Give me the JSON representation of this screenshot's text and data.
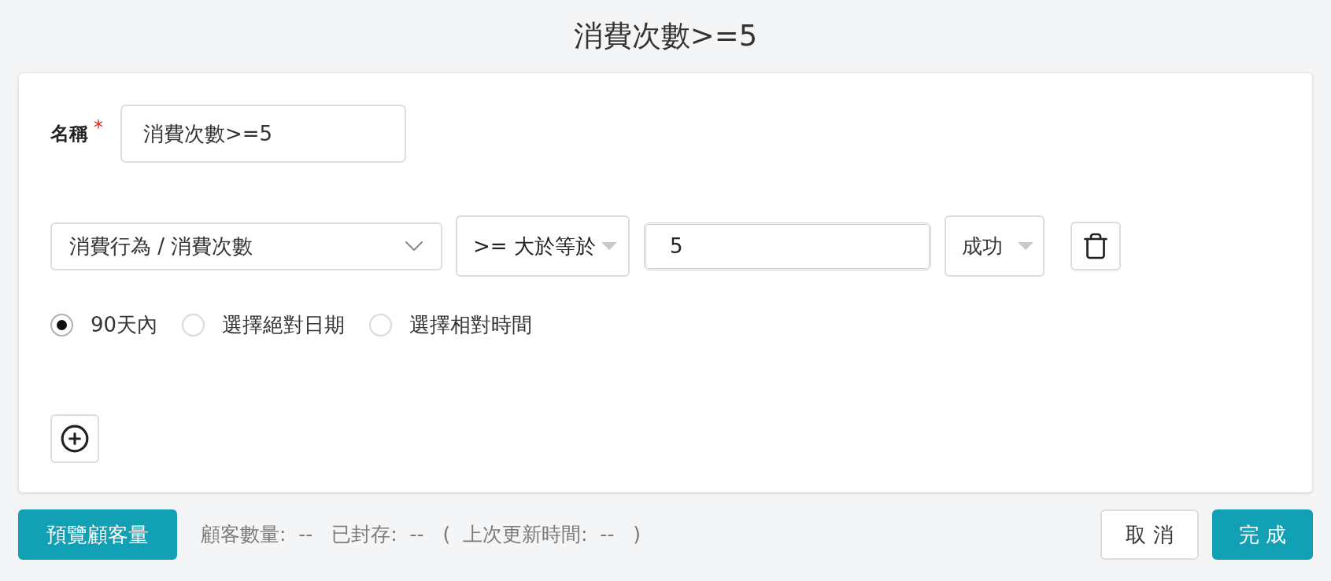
{
  "page_title": "消費次數>=5",
  "name_field": {
    "label": "名稱",
    "required_mark": "*",
    "value": "消費次數>=5"
  },
  "conditions": [
    {
      "field": {
        "value": "消費行為 / 消費次數"
      },
      "operator": {
        "value": ">= 大於等於"
      },
      "amount": {
        "value": "5"
      },
      "status": {
        "value": "成功"
      },
      "time_range": [
        {
          "label": "90天內",
          "selected": true
        },
        {
          "label": "選擇絕對日期",
          "selected": false
        },
        {
          "label": "選擇相對時間",
          "selected": false
        }
      ]
    }
  ],
  "footer": {
    "preview_button": "預覽顧客量",
    "stats": "顧客數量:  --   已封存:  --   (  上次更新時間:  --   )",
    "cancel_button": "取 消",
    "done_button": "完 成"
  }
}
